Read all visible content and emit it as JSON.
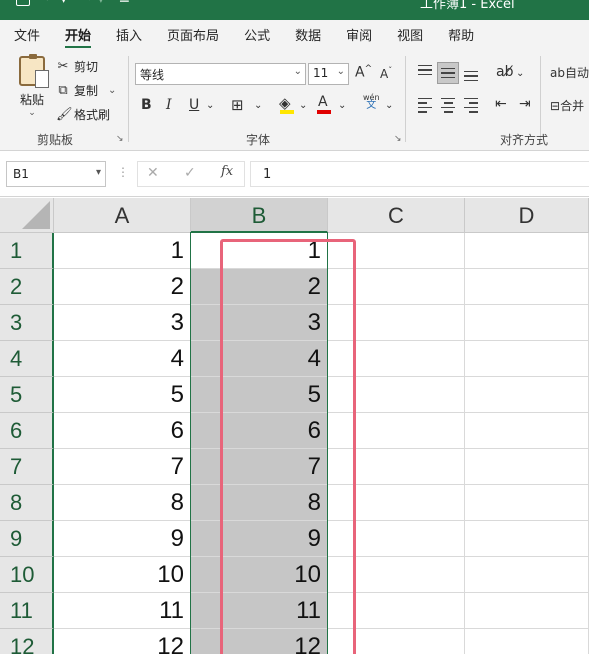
{
  "app": {
    "title": "工作簿1  -  Excel"
  },
  "ribbon_tabs": [
    "文件",
    "开始",
    "插入",
    "页面布局",
    "公式",
    "数据",
    "审阅",
    "视图",
    "帮助"
  ],
  "active_tab": "开始",
  "clipboard": {
    "paste_label": "粘贴",
    "cut_label": "剪切",
    "copy_label": "复制",
    "format_painter_label": "格式刷",
    "group_label": "剪贴板"
  },
  "font": {
    "font_name": "等线",
    "font_size": "11",
    "grow": "A",
    "shrink": "A",
    "bold": "B",
    "italic": "I",
    "underline": "U",
    "font_color_glyph": "A",
    "phonetic_top": "wén",
    "phonetic_bottom": "文",
    "group_label": "字体",
    "fill_color": "#ffe600",
    "font_color": "#e00000"
  },
  "alignment": {
    "wrap_label": "自动",
    "merge_label": "合并",
    "group_label": "对齐方式"
  },
  "formula_bar": {
    "name_box": "B1",
    "formula": "1"
  },
  "grid": {
    "columns": [
      "A",
      "B",
      "C",
      "D"
    ],
    "selected_column": "B",
    "rows": [
      {
        "row": "1",
        "A": "1",
        "B": "1"
      },
      {
        "row": "2",
        "A": "2",
        "B": "2"
      },
      {
        "row": "3",
        "A": "3",
        "B": "3"
      },
      {
        "row": "4",
        "A": "4",
        "B": "4"
      },
      {
        "row": "5",
        "A": "5",
        "B": "5"
      },
      {
        "row": "6",
        "A": "6",
        "B": "6"
      },
      {
        "row": "7",
        "A": "7",
        "B": "7"
      },
      {
        "row": "8",
        "A": "8",
        "B": "8"
      },
      {
        "row": "9",
        "A": "9",
        "B": "9"
      },
      {
        "row": "10",
        "A": "10",
        "B": "10"
      },
      {
        "row": "11",
        "A": "11",
        "B": "11"
      },
      {
        "row": "12",
        "A": "12",
        "B": "12"
      }
    ]
  },
  "colors": {
    "accent": "#217346",
    "annotation": "#e8647a",
    "selection_fill": "#c6c6c6"
  }
}
